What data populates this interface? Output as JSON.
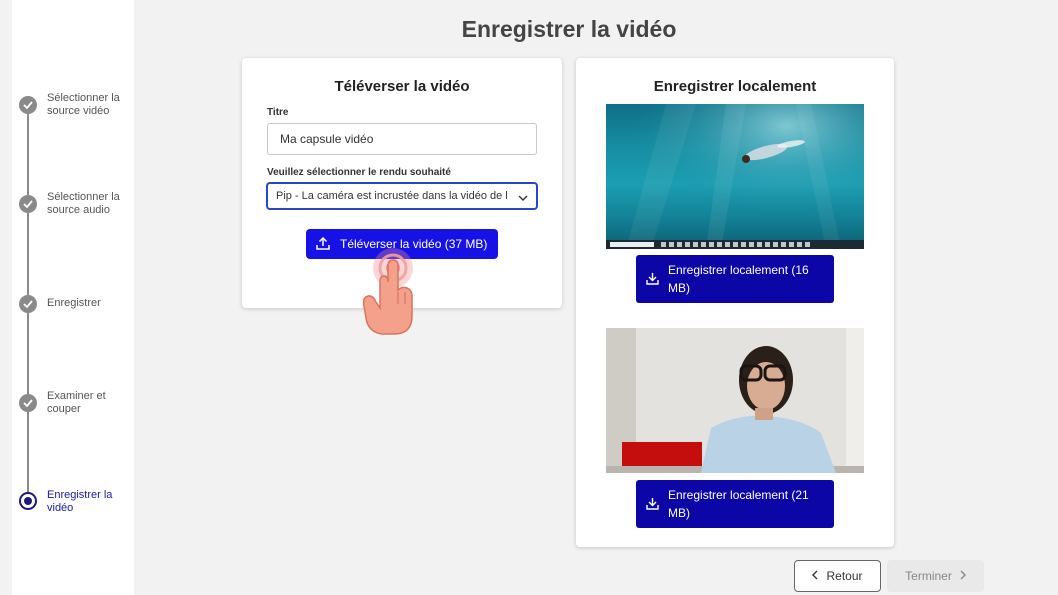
{
  "sidebar": {
    "steps": [
      {
        "label": "Sélectionner la source vidéo",
        "status": "done"
      },
      {
        "label": "Sélectionner la source audio",
        "status": "done"
      },
      {
        "label": "Enregistrer",
        "status": "done"
      },
      {
        "label": "Examiner et couper",
        "status": "done"
      },
      {
        "label": "Enregistrer la vidéo",
        "status": "active"
      }
    ]
  },
  "page": {
    "title": "Enregistrer la vidéo"
  },
  "upload_card": {
    "title": "Téléverser la vidéo",
    "title_label": "Titre",
    "title_value": "Ma capsule vidéo",
    "render_label": "Veuillez sélectionner le rendu souhaité",
    "render_selected": "Pip - La caméra est incrustée dans la vidéo de l",
    "upload_button": "Téléverser la vidéo (37 MB)"
  },
  "local_card": {
    "title": "Enregistrer localement",
    "download_buttons": [
      "Enregistrer localement (16 MB)",
      "Enregistrer localement (21 MB)"
    ]
  },
  "footer": {
    "back_label": "Retour",
    "finish_label": "Terminer"
  },
  "colors": {
    "primary": "#1612e6",
    "primary_dark": "#0d06a6",
    "active_step": "#1a1a7a"
  },
  "icons": [
    "check-icon",
    "radio-active-icon",
    "chevron-down-icon",
    "upload-icon",
    "download-icon",
    "chevron-left-icon",
    "chevron-right-icon",
    "pointer-hand-icon"
  ]
}
